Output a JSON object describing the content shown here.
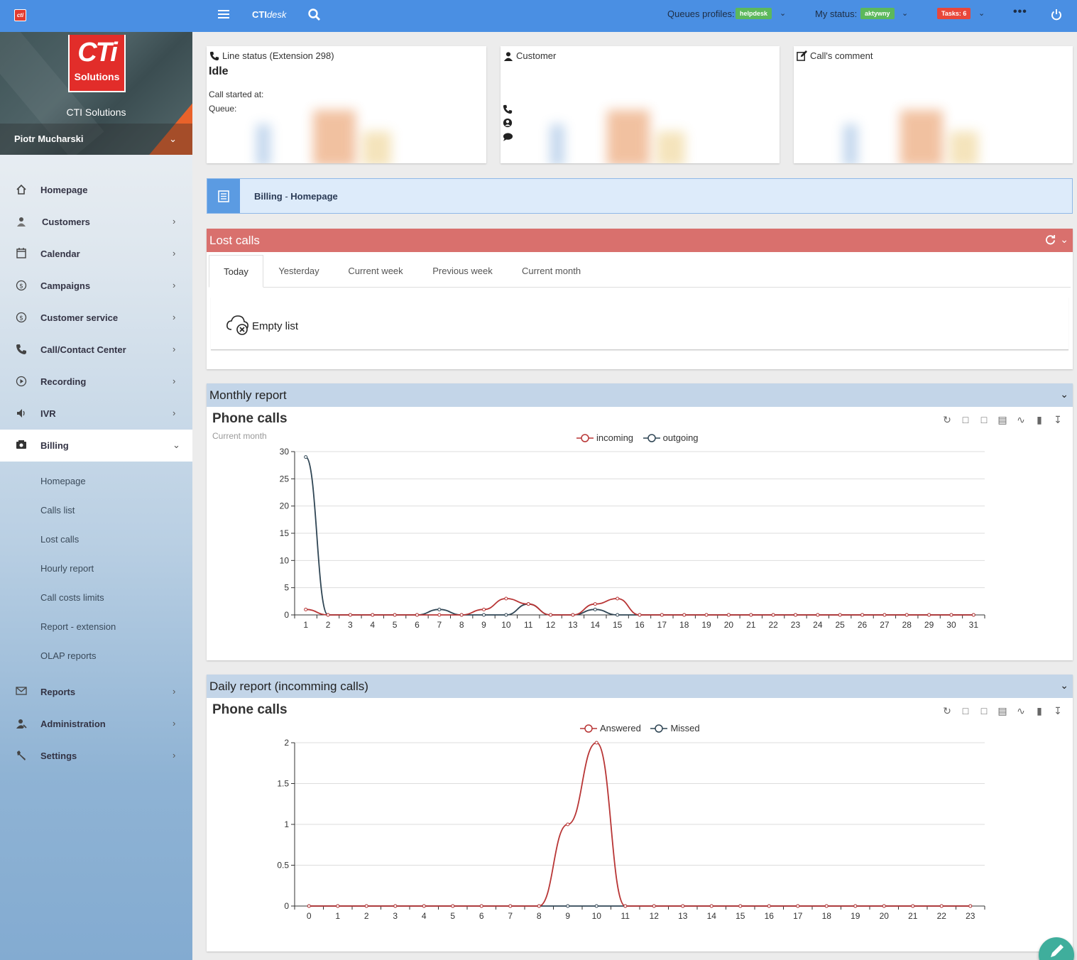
{
  "topbar": {
    "logo": "cti",
    "brand_bold": "CTI",
    "brand_italic": "desk",
    "queues_label": "Queues profiles:",
    "queues_value": "helpdesk",
    "status_label": "My status:",
    "status_value": "aktywny",
    "tasks": "Tasks: 6",
    "more": "•••"
  },
  "sidebar": {
    "logo_text": "CTi",
    "logo_sub": "Solutions",
    "company": "CTI Solutions",
    "user": "Piotr Mucharski",
    "items": [
      {
        "label": "Homepage",
        "icon": "home-icon"
      },
      {
        "label": "Customers",
        "icon": "customers-icon"
      },
      {
        "label": "Calendar",
        "icon": "calendar-icon"
      },
      {
        "label": "Campaigns",
        "icon": "dollar-icon"
      },
      {
        "label": "Customer service",
        "icon": "dollar-icon"
      },
      {
        "label": "Call/Contact Center",
        "icon": "phone-icon"
      },
      {
        "label": "Recording",
        "icon": "play-icon"
      },
      {
        "label": "IVR",
        "icon": "speaker-icon"
      },
      {
        "label": "Billing",
        "icon": "billing-icon"
      },
      {
        "label": "Reports",
        "icon": "envelope-icon"
      },
      {
        "label": "Administration",
        "icon": "admin-icon"
      },
      {
        "label": "Settings",
        "icon": "wrench-icon"
      }
    ],
    "billing_sub": [
      "Homepage",
      "Calls list",
      "Lost calls",
      "Hourly report",
      "Call costs limits",
      "Report - extension",
      "OLAP reports"
    ]
  },
  "line_status": {
    "title": "Line status (Extension 298)",
    "state": "Idle",
    "call_started": "Call started at:",
    "queue": "Queue:"
  },
  "customer_card": {
    "title": "Customer"
  },
  "comment_card": {
    "title": "Call's comment"
  },
  "breadcrumb": {
    "section": "Billing",
    "sep": " - ",
    "page": "Homepage"
  },
  "lost_calls": {
    "title": "Lost calls",
    "tabs": [
      "Today",
      "Yesterday",
      "Current week",
      "Previous week",
      "Current month"
    ],
    "empty": "Empty list"
  },
  "monthly": {
    "panel_title": "Monthly report",
    "chart_title": "Phone calls",
    "subtitle": "Current month"
  },
  "daily": {
    "panel_title": "Daily report (incomming calls)",
    "chart_title": "Phone calls"
  },
  "colors": {
    "red": "#b83535",
    "dark": "#2f4554",
    "lost_head": "#d9706d",
    "report_head": "#c3d5e8"
  },
  "chart_data": [
    {
      "type": "line",
      "title": "Phone calls",
      "subtitle": "Current month",
      "x": [
        1,
        2,
        3,
        4,
        5,
        6,
        7,
        8,
        9,
        10,
        11,
        12,
        13,
        14,
        15,
        16,
        17,
        18,
        19,
        20,
        21,
        22,
        23,
        24,
        25,
        26,
        27,
        28,
        29,
        30,
        31
      ],
      "ylim": [
        0,
        30
      ],
      "yticks": [
        0,
        5,
        10,
        15,
        20,
        25,
        30
      ],
      "legend": "top-center",
      "series": [
        {
          "name": "incoming",
          "color": "#b83535",
          "values": [
            1,
            0,
            0,
            0,
            0,
            0,
            0,
            0,
            1,
            3,
            2,
            0,
            0,
            2,
            3,
            0,
            0,
            0,
            0,
            0,
            0,
            0,
            0,
            0,
            0,
            0,
            0,
            0,
            0,
            0,
            0
          ]
        },
        {
          "name": "outgoing",
          "color": "#2f4554",
          "values": [
            29,
            0,
            0,
            0,
            0,
            0,
            1,
            0,
            0,
            0,
            2,
            0,
            0,
            1,
            0,
            0,
            0,
            0,
            0,
            0,
            0,
            0,
            0,
            0,
            0,
            0,
            0,
            0,
            0,
            0,
            0
          ]
        }
      ]
    },
    {
      "type": "line",
      "title": "Phone calls",
      "x": [
        0,
        1,
        2,
        3,
        4,
        5,
        6,
        7,
        8,
        9,
        10,
        11,
        12,
        13,
        14,
        15,
        16,
        17,
        18,
        19,
        20,
        21,
        22,
        23
      ],
      "ylim": [
        0,
        2
      ],
      "yticks": [
        0,
        0.5,
        1,
        1.5,
        2
      ],
      "legend": "top-center",
      "series": [
        {
          "name": "Answered",
          "color": "#b83535",
          "values": [
            0,
            0,
            0,
            0,
            0,
            0,
            0,
            0,
            0,
            1,
            2,
            0,
            0,
            0,
            0,
            0,
            0,
            0,
            0,
            0,
            0,
            0,
            0,
            0
          ]
        },
        {
          "name": "Missed",
          "color": "#2f4554",
          "values": [
            0,
            0,
            0,
            0,
            0,
            0,
            0,
            0,
            0,
            0,
            0,
            0,
            0,
            0,
            0,
            0,
            0,
            0,
            0,
            0,
            0,
            0,
            0,
            0
          ]
        }
      ]
    }
  ]
}
